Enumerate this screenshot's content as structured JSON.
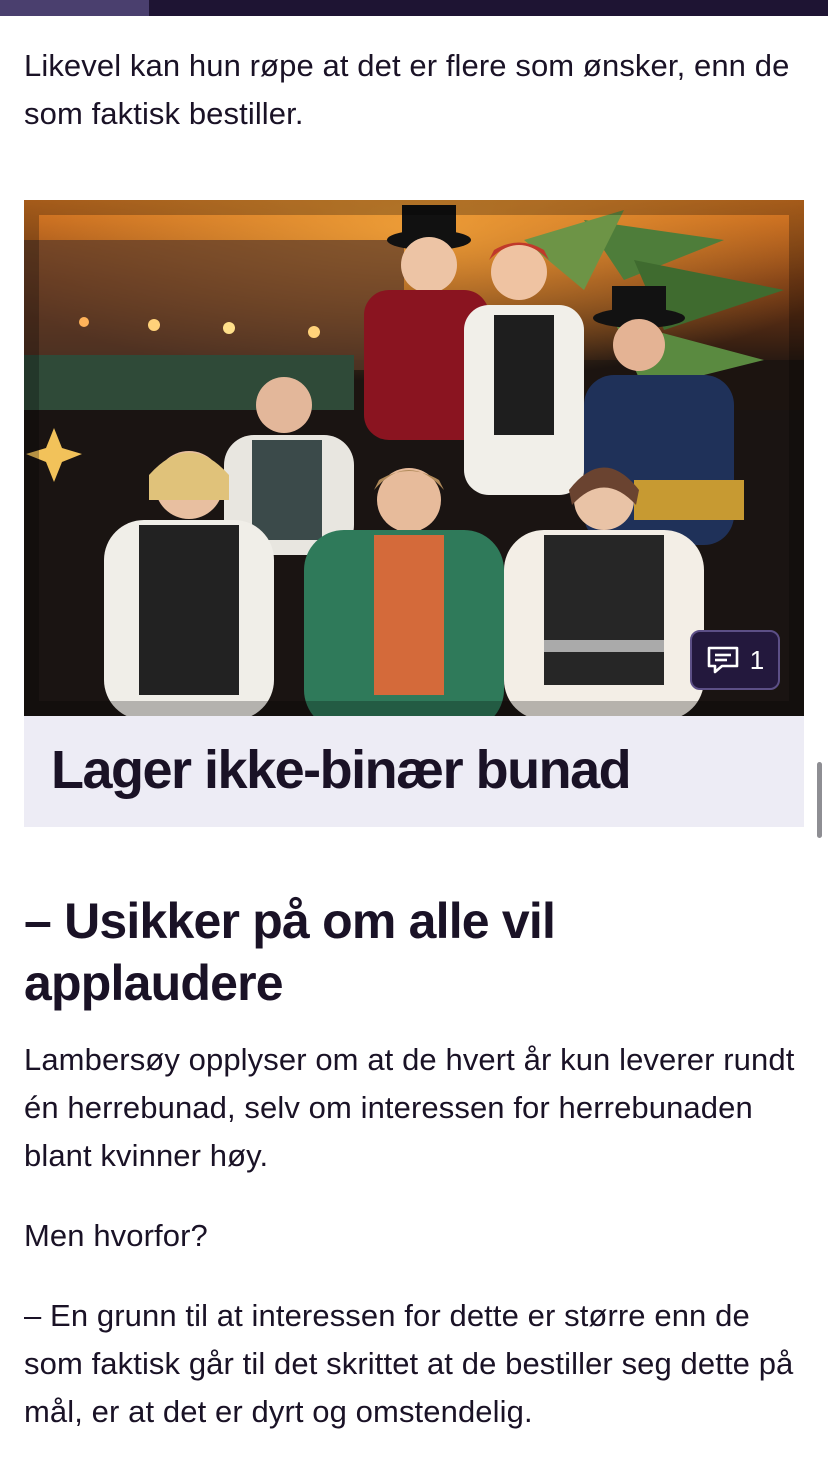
{
  "reading_progress": 0.18,
  "paragraphs": {
    "intro": "Likevel kan hun røpe at det er flere som ønsker, enn de som faktisk bestiller.",
    "body1": "Lambersøy opplyser om at de hvert år kun leverer rundt én herrebunad, selv om interessen for herrebunaden blant kvinner høy.",
    "body2": "Men hvorfor?",
    "body3": "– En grunn til at interessen for dette er større enn de som faktisk går til det skrittet at de bestiller seg dette på mål, er at det er dyrt og omstendelig."
  },
  "teaser": {
    "title": "Lager ikke-binær bunad",
    "comment_count": "1",
    "comment_icon": "comment-icon"
  },
  "heading": "– Usikker på om alle vil applaudere",
  "colors": {
    "progress_track": "#1e1433",
    "progress_fill": "#4a3f6e",
    "caption_bg": "#edecf5",
    "text": "#1a1226"
  }
}
